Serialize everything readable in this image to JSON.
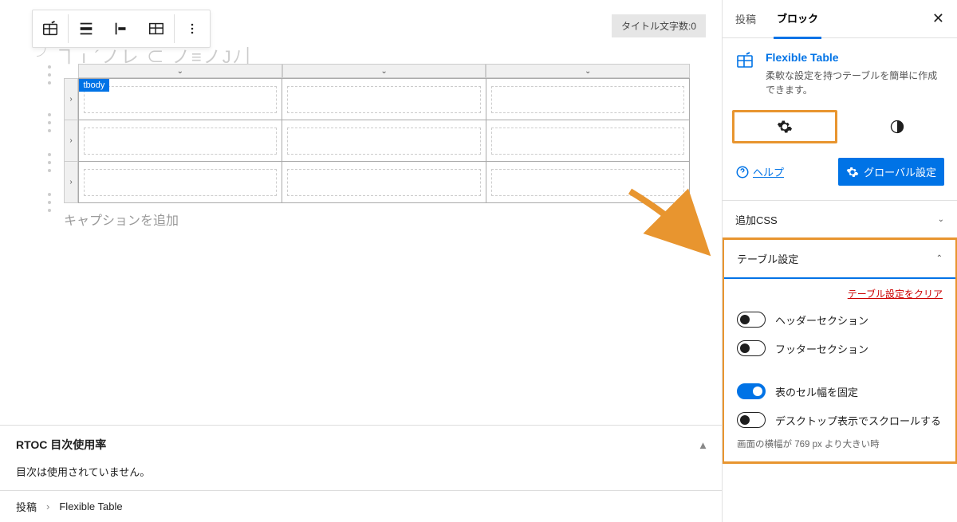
{
  "toolbar": {
    "title_count": "タイトル文字数:0"
  },
  "editor": {
    "tbody_tag": "tbody",
    "caption_placeholder": "キャプションを追加"
  },
  "bottom": {
    "rtoc_title": "RTOC 目次使用率",
    "rtoc_body": "目次は使用されていません。"
  },
  "breadcrumb": {
    "root": "投稿",
    "current": "Flexible Table"
  },
  "sidebar": {
    "tabs": {
      "post": "投稿",
      "block": "ブロック"
    },
    "block": {
      "title": "Flexible Table",
      "desc": "柔軟な設定を持つテーブルを簡単に作成できます。"
    },
    "help": "ヘルプ",
    "global_btn": "グローバル設定",
    "panels": {
      "css": "追加CSS",
      "table": "テーブル設定",
      "clear": "テーブル設定をクリア",
      "header_section": "ヘッダーセクション",
      "footer_section": "フッターセクション",
      "fixed_width": "表のセル幅を固定",
      "desktop_scroll": "デスクトップ表示でスクロールする",
      "hint": "画面の横幅が 769 px より大きい時"
    }
  }
}
